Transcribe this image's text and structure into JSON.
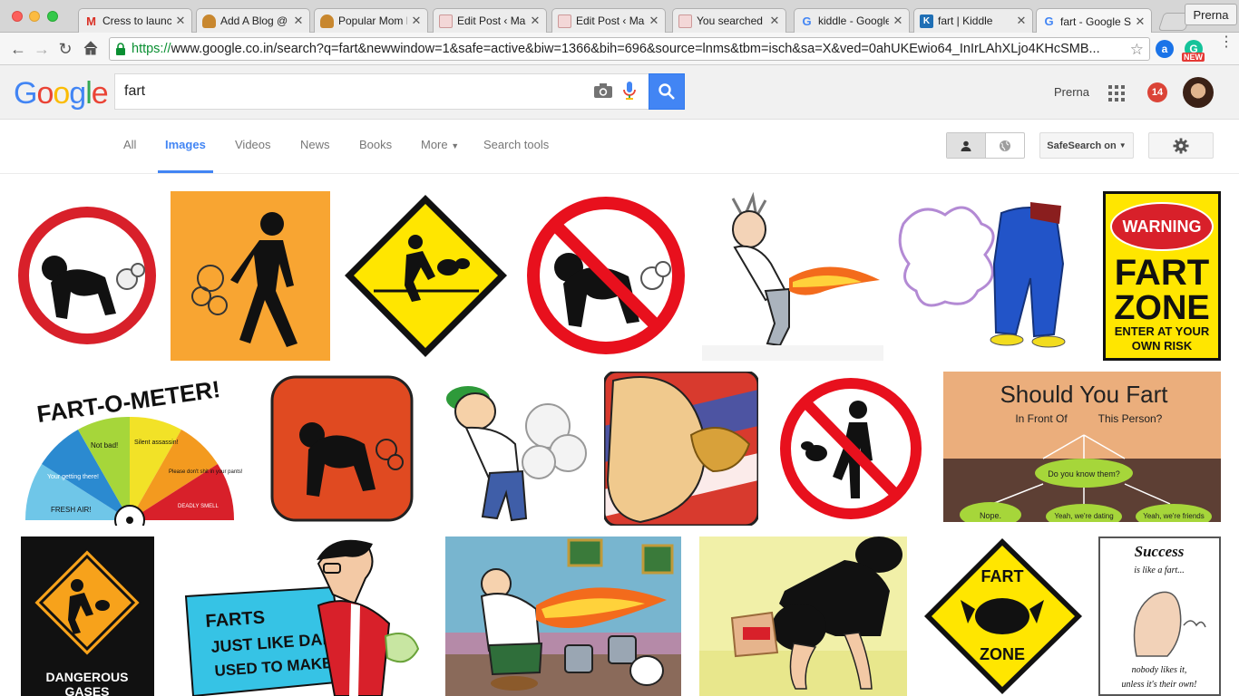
{
  "browser": {
    "tabs": [
      {
        "label": "Cress to launch",
        "icon": "gmail-icon"
      },
      {
        "label": "Add A Blog @ T",
        "icon": "muffin-icon"
      },
      {
        "label": "Popular Mom B",
        "icon": "muffin-icon"
      },
      {
        "label": "Edit Post ‹ Maa",
        "icon": "mom-blog-icon"
      },
      {
        "label": "Edit Post ‹ Maa",
        "icon": "mom-blog-icon"
      },
      {
        "label": "You searched fo",
        "icon": "mom-blog-icon"
      },
      {
        "label": "kiddle - Google",
        "icon": "google-icon"
      },
      {
        "label": "fart | Kiddle",
        "icon": "kiddle-icon"
      },
      {
        "label": "fart - Google Se",
        "icon": "google-icon"
      }
    ],
    "profile": "Prerna",
    "url_scheme": "https://",
    "url_rest": "www.google.co.in/search?q=fart&newwindow=1&safe=active&biw=1366&bih=696&source=lnms&tbm=isch&sa=X&ved=0ahUKEwio64_InIrLAhXLjo4KHcSMB...",
    "extension_badge": "NEW"
  },
  "google": {
    "logo_letters": [
      {
        "ch": "G",
        "color": "#4285f4"
      },
      {
        "ch": "o",
        "color": "#ea4335"
      },
      {
        "ch": "o",
        "color": "#fbbc05"
      },
      {
        "ch": "g",
        "color": "#4285f4"
      },
      {
        "ch": "l",
        "color": "#34a853"
      },
      {
        "ch": "e",
        "color": "#ea4335"
      }
    ],
    "query": "fart",
    "user_name": "Prerna",
    "notifications": "14"
  },
  "search_tabs": {
    "all": "All",
    "images": "Images",
    "videos": "Videos",
    "news": "News",
    "books": "Books",
    "more": "More",
    "tools": "Search tools",
    "safesearch": "SafeSearch on"
  },
  "images": {
    "fart_o_meter": {
      "title": "FART-O-METER!",
      "fresh_air": "FRESH AIR!",
      "your_getting": "Your getting there!",
      "not_bad": "Not bad!",
      "silent": "Silent assassin!",
      "pleasedont": "Please don't shit in your pants!",
      "deadly": "DEADLY SMELL"
    },
    "should_you_fart": {
      "title": "Should You Fart",
      "in_front": "In Front Of",
      "this_person": "This Person?",
      "know": "Do you know them?",
      "nope": "Nope.",
      "dating": "Yeah, we're dating",
      "friends": "Yeah, we're friends"
    },
    "warning_sign": {
      "warning": "WARNING",
      "fart": "FART",
      "zone": "ZONE",
      "enter": "ENTER AT YOUR",
      "risk": "OWN RISK"
    },
    "dangerous": {
      "line1": "DANGEROUS",
      "line2": "GASES"
    },
    "dad": {
      "line1": "FARTS",
      "line2": "JUST LIKE DAD",
      "line3": "USED TO MAKE"
    },
    "fart_zone": {
      "top": "FART",
      "bottom": "ZONE"
    },
    "success": {
      "title": "Success",
      "line1": "is like a fart...",
      "line2": "nobody likes it,",
      "line3": "unless it's their own!"
    }
  }
}
